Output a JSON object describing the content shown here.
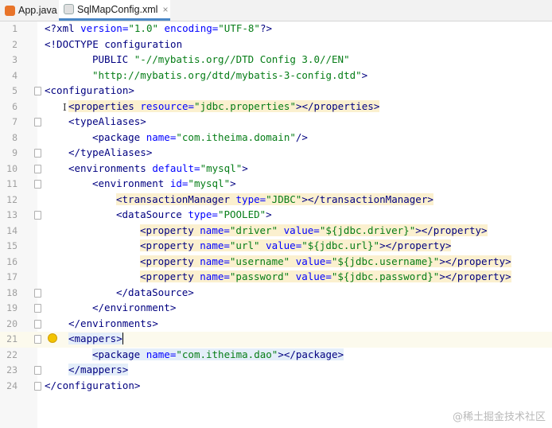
{
  "tabs": [
    {
      "label": "App.java",
      "icon": "java-file-icon",
      "closable": false,
      "active": false
    },
    {
      "label": "SqlMapConfig.xml",
      "icon": "xml-file-icon",
      "closable": true,
      "active": true
    }
  ],
  "close_glyph": "×",
  "lines": [
    {
      "n": "1",
      "indent": 0,
      "fold": false,
      "hl": "",
      "parts": [
        [
          "t",
          "<?xml "
        ],
        [
          "a",
          "version="
        ],
        [
          "v",
          "\"1.0\""
        ],
        [
          "a",
          " encoding="
        ],
        [
          "v",
          "\"UTF-8\""
        ],
        [
          "t",
          "?>"
        ]
      ]
    },
    {
      "n": "2",
      "indent": 0,
      "fold": false,
      "hl": "",
      "parts": [
        [
          "t",
          "<!DOCTYPE configuration"
        ]
      ]
    },
    {
      "n": "3",
      "indent": 2,
      "fold": false,
      "hl": "",
      "parts": [
        [
          "t",
          "PUBLIC "
        ],
        [
          "v",
          "\"-//mybatis.org//DTD Config 3.0//EN\""
        ]
      ]
    },
    {
      "n": "4",
      "indent": 2,
      "fold": false,
      "hl": "",
      "parts": [
        [
          "v",
          "\"http://mybatis.org/dtd/mybatis-3-config.dtd\""
        ],
        [
          "t",
          ">"
        ]
      ]
    },
    {
      "n": "5",
      "indent": 0,
      "fold": true,
      "hl": "",
      "parts": [
        [
          "t",
          "<configuration>"
        ]
      ]
    },
    {
      "n": "6",
      "indent": 1,
      "fold": false,
      "hl": "hl",
      "parts": [
        [
          "t",
          "<properties "
        ],
        [
          "a",
          "resource="
        ],
        [
          "v",
          "\"jdbc.properties\""
        ],
        [
          "t",
          "></properties>"
        ]
      ]
    },
    {
      "n": "7",
      "indent": 1,
      "fold": true,
      "hl": "",
      "parts": [
        [
          "t",
          "<typeAliases>"
        ]
      ]
    },
    {
      "n": "8",
      "indent": 2,
      "fold": false,
      "hl": "",
      "parts": [
        [
          "t",
          "<package "
        ],
        [
          "a",
          "name="
        ],
        [
          "v",
          "\"com.itheima.domain\""
        ],
        [
          "t",
          "/>"
        ]
      ]
    },
    {
      "n": "9",
      "indent": 1,
      "fold": true,
      "hl": "",
      "parts": [
        [
          "t",
          "</typeAliases>"
        ]
      ]
    },
    {
      "n": "10",
      "indent": 1,
      "fold": true,
      "hl": "",
      "parts": [
        [
          "t",
          "<environments "
        ],
        [
          "a",
          "default="
        ],
        [
          "v",
          "\"mysql\""
        ],
        [
          "t",
          ">"
        ]
      ]
    },
    {
      "n": "11",
      "indent": 2,
      "fold": true,
      "hl": "",
      "parts": [
        [
          "t",
          "<environment "
        ],
        [
          "a",
          "id="
        ],
        [
          "v",
          "\"mysql\""
        ],
        [
          "t",
          ">"
        ]
      ]
    },
    {
      "n": "12",
      "indent": 3,
      "fold": false,
      "hl": "hl",
      "parts": [
        [
          "t",
          "<transactionManager "
        ],
        [
          "a",
          "type="
        ],
        [
          "v",
          "\"JDBC\""
        ],
        [
          "t",
          "></transactionManager>"
        ]
      ]
    },
    {
      "n": "13",
      "indent": 3,
      "fold": true,
      "hl": "",
      "parts": [
        [
          "t",
          "<dataSource "
        ],
        [
          "a",
          "type="
        ],
        [
          "v",
          "\"POOLED\""
        ],
        [
          "t",
          ">"
        ]
      ]
    },
    {
      "n": "14",
      "indent": 4,
      "fold": false,
      "hl": "hl",
      "parts": [
        [
          "t",
          "<property "
        ],
        [
          "a",
          "name="
        ],
        [
          "v",
          "\"driver\""
        ],
        [
          "a",
          " value="
        ],
        [
          "v",
          "\"${jdbc.driver}\""
        ],
        [
          "t",
          "></property>"
        ]
      ]
    },
    {
      "n": "15",
      "indent": 4,
      "fold": false,
      "hl": "hl",
      "parts": [
        [
          "t",
          "<property "
        ],
        [
          "a",
          "name="
        ],
        [
          "v",
          "\"url\""
        ],
        [
          "a",
          " value="
        ],
        [
          "v",
          "\"${jdbc.url}\""
        ],
        [
          "t",
          "></property>"
        ]
      ]
    },
    {
      "n": "16",
      "indent": 4,
      "fold": false,
      "hl": "hl",
      "parts": [
        [
          "t",
          "<property "
        ],
        [
          "a",
          "name="
        ],
        [
          "v",
          "\"username\""
        ],
        [
          "a",
          " value="
        ],
        [
          "v",
          "\"${jdbc.username}\""
        ],
        [
          "t",
          "></property>"
        ]
      ]
    },
    {
      "n": "17",
      "indent": 4,
      "fold": false,
      "hl": "hl",
      "parts": [
        [
          "t",
          "<property "
        ],
        [
          "a",
          "name="
        ],
        [
          "v",
          "\"password\""
        ],
        [
          "a",
          " value="
        ],
        [
          "v",
          "\"${jdbc.password}\""
        ],
        [
          "t",
          "></property>"
        ]
      ]
    },
    {
      "n": "18",
      "indent": 3,
      "fold": true,
      "hl": "",
      "parts": [
        [
          "t",
          "</dataSource>"
        ]
      ]
    },
    {
      "n": "19",
      "indent": 2,
      "fold": true,
      "hl": "",
      "parts": [
        [
          "t",
          "</environment>"
        ]
      ]
    },
    {
      "n": "20",
      "indent": 1,
      "fold": true,
      "hl": "",
      "parts": [
        [
          "t",
          "</environments>"
        ]
      ]
    },
    {
      "n": "21",
      "indent": 1,
      "fold": true,
      "hl": "hl2",
      "current": true,
      "bulb": true,
      "caret": true,
      "parts": [
        [
          "t",
          "<mappers>"
        ]
      ]
    },
    {
      "n": "22",
      "indent": 2,
      "fold": false,
      "hl": "hl2",
      "parts": [
        [
          "t",
          "<package "
        ],
        [
          "a",
          "name="
        ],
        [
          "v",
          "\"com.itheima.dao\""
        ],
        [
          "t",
          "></package>"
        ]
      ]
    },
    {
      "n": "23",
      "indent": 1,
      "fold": true,
      "hl": "hl2",
      "parts": [
        [
          "t",
          "</mappers>"
        ]
      ]
    },
    {
      "n": "24",
      "indent": 0,
      "fold": true,
      "hl": "",
      "parts": [
        [
          "t",
          "</configuration>"
        ]
      ]
    }
  ],
  "watermark": "@稀土掘金技术社区",
  "colors": {
    "tag": "#000080",
    "attribute": "#0000ff",
    "string": "#067d17",
    "highlight": "#fbf0cf",
    "active_tab_underline": "#4a88c7"
  }
}
